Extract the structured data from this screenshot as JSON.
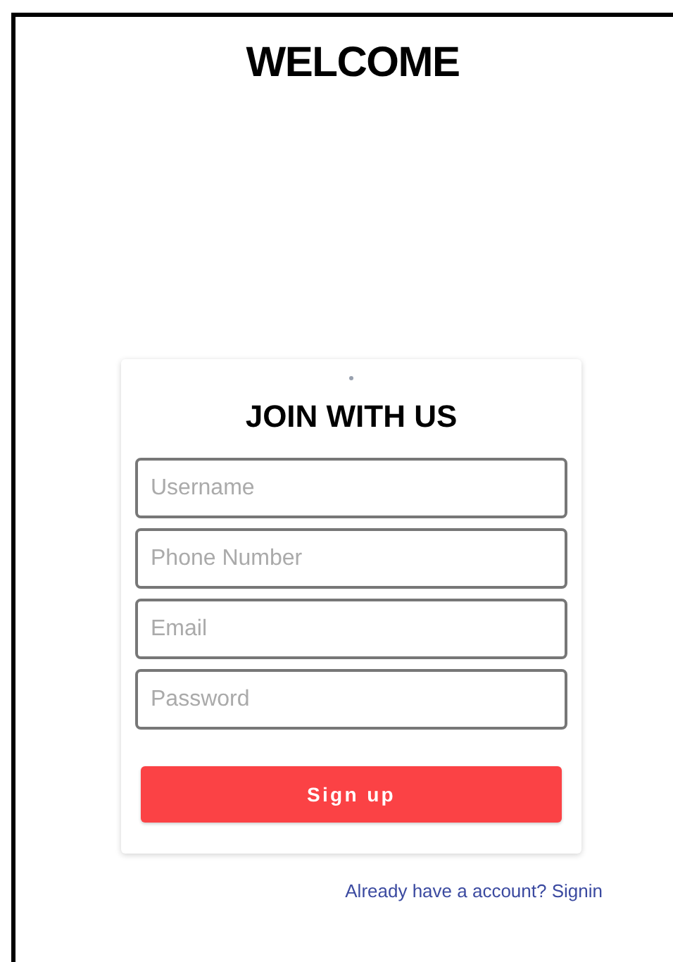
{
  "title": "WELCOME",
  "form": {
    "heading": "JOIN WITH US",
    "fields": [
      {
        "placeholder": "Username"
      },
      {
        "placeholder": "Phone Number"
      },
      {
        "placeholder": "Email"
      },
      {
        "placeholder": "Password"
      }
    ],
    "submit": "Sign up"
  },
  "signin_link": "Already have a account? Signin"
}
